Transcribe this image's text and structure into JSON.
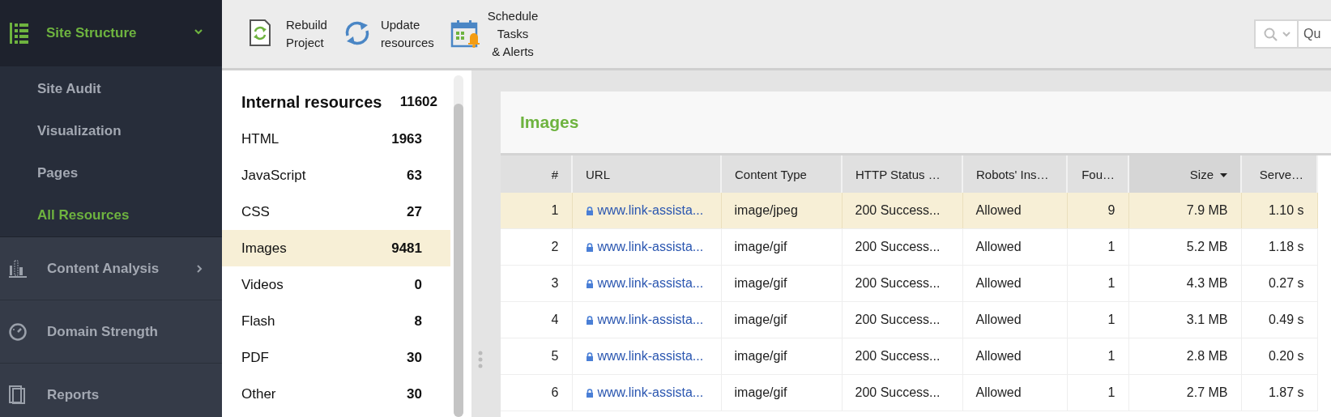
{
  "sidebar": {
    "header": {
      "label": "Site Structure",
      "expanded": true
    },
    "items": [
      {
        "label": "Site Audit",
        "selected": false
      },
      {
        "label": "Visualization",
        "selected": false
      },
      {
        "label": "Pages",
        "selected": false
      },
      {
        "label": "All Resources",
        "selected": true
      }
    ],
    "sections": [
      {
        "label": "Content Analysis",
        "kind": "chart"
      },
      {
        "label": "Domain Strength",
        "kind": "gauge"
      },
      {
        "label": "Reports",
        "kind": "report"
      }
    ]
  },
  "toolbar": {
    "buttons": [
      {
        "label": "Rebuild\nProject",
        "kind": "rebuild"
      },
      {
        "label": "Update\nresources",
        "kind": "update"
      },
      {
        "label": "Schedule\nTasks\n& Alerts",
        "kind": "schedule"
      }
    ],
    "search": {
      "placeholder": "Qu"
    }
  },
  "resources": {
    "title": "Internal resources",
    "total": "11602",
    "items": [
      {
        "label": "HTML",
        "count": "1963",
        "selected": false
      },
      {
        "label": "JavaScript",
        "count": "63",
        "selected": false
      },
      {
        "label": "CSS",
        "count": "27",
        "selected": false
      },
      {
        "label": "Images",
        "count": "9481",
        "selected": true
      },
      {
        "label": "Videos",
        "count": "0",
        "selected": false
      },
      {
        "label": "Flash",
        "count": "8",
        "selected": false
      },
      {
        "label": "PDF",
        "count": "30",
        "selected": false
      },
      {
        "label": "Other",
        "count": "30",
        "selected": false
      }
    ]
  },
  "table": {
    "title": "Images",
    "columns": [
      {
        "label": "#",
        "sorted": false
      },
      {
        "label": "URL",
        "sorted": false
      },
      {
        "label": "Content Type",
        "sorted": false
      },
      {
        "label": "HTTP Status …",
        "sorted": false
      },
      {
        "label": "Robots' Ins…",
        "sorted": false
      },
      {
        "label": "Fou…",
        "sorted": false
      },
      {
        "label": "Size",
        "sorted": true
      },
      {
        "label": "Serve…",
        "sorted": false
      }
    ],
    "rows": [
      {
        "selected": true,
        "cells": [
          "1",
          "www.link-assista...",
          "image/jpeg",
          "200 Success...",
          "Allowed",
          "9",
          "7.9 MB",
          "1.10 s"
        ]
      },
      {
        "selected": false,
        "cells": [
          "2",
          "www.link-assista...",
          "image/gif",
          "200 Success...",
          "Allowed",
          "1",
          "5.2 MB",
          "1.18 s"
        ]
      },
      {
        "selected": false,
        "cells": [
          "3",
          "www.link-assista...",
          "image/gif",
          "200 Success...",
          "Allowed",
          "1",
          "4.3 MB",
          "0.27 s"
        ]
      },
      {
        "selected": false,
        "cells": [
          "4",
          "www.link-assista...",
          "image/gif",
          "200 Success...",
          "Allowed",
          "1",
          "3.1 MB",
          "0.49 s"
        ]
      },
      {
        "selected": false,
        "cells": [
          "5",
          "www.link-assista...",
          "image/gif",
          "200 Success...",
          "Allowed",
          "1",
          "2.8 MB",
          "0.20 s"
        ]
      },
      {
        "selected": false,
        "cells": [
          "6",
          "www.link-assista...",
          "image/gif",
          "200 Success...",
          "Allowed",
          "1",
          "2.7 MB",
          "1.87 s"
        ]
      }
    ]
  }
}
